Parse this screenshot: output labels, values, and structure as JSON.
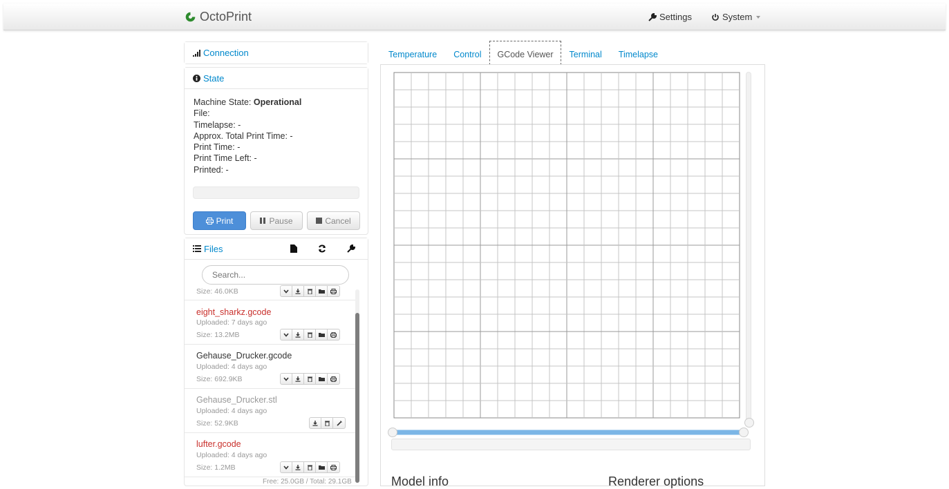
{
  "navbar": {
    "brand": "OctoPrint",
    "settings_label": "Settings",
    "system_label": "System"
  },
  "sidebar": {
    "connection": {
      "title": "Connection"
    },
    "state": {
      "title": "State",
      "machine_state_label": "Machine State: ",
      "machine_state_value": "Operational",
      "file_label": "File:",
      "timelapse": "Timelapse: -",
      "approx_total": "Approx. Total Print Time: -",
      "print_time": "Print Time: -",
      "print_time_left": "Print Time Left: -",
      "printed": "Printed: -",
      "progress": 0,
      "buttons": {
        "print": "Print",
        "pause": "Pause",
        "cancel": "Cancel"
      }
    },
    "files": {
      "title": "Files",
      "search_placeholder": "Search...",
      "partial_size": "Size: 46.0KB",
      "items": [
        {
          "name": "eight_sharkz.gcode",
          "uploaded": "Uploaded: 7 days ago",
          "size": "Size: 13.2MB",
          "status": "failed"
        },
        {
          "name": "Gehause_Drucker.gcode",
          "uploaded": "Uploaded: 4 days ago",
          "size": "Size: 692.9KB",
          "status": "normal"
        },
        {
          "name": "Gehause_Drucker.stl",
          "uploaded": "Uploaded: 4 days ago",
          "size": "Size: 52.9KB",
          "status": "model"
        },
        {
          "name": "lufter.gcode",
          "uploaded": "Uploaded: 4 days ago",
          "size": "Size: 1.2MB",
          "status": "failed"
        }
      ],
      "footer": "Free: 25.0GB / Total: 29.1GB"
    }
  },
  "tabs": [
    {
      "label": "Temperature",
      "active": false
    },
    {
      "label": "Control",
      "active": false
    },
    {
      "label": "GCode Viewer",
      "active": true
    },
    {
      "label": "Terminal",
      "active": false
    },
    {
      "label": "Timelapse",
      "active": false
    }
  ],
  "gcode_viewer": {
    "model_info_title": "Model info",
    "renderer_options_title": "Renderer options"
  },
  "colors": {
    "link": "#0088cc",
    "failed_file": "#c9302c",
    "print_button": "#4d8fd9",
    "brand_logo": "#2e8b2e"
  }
}
